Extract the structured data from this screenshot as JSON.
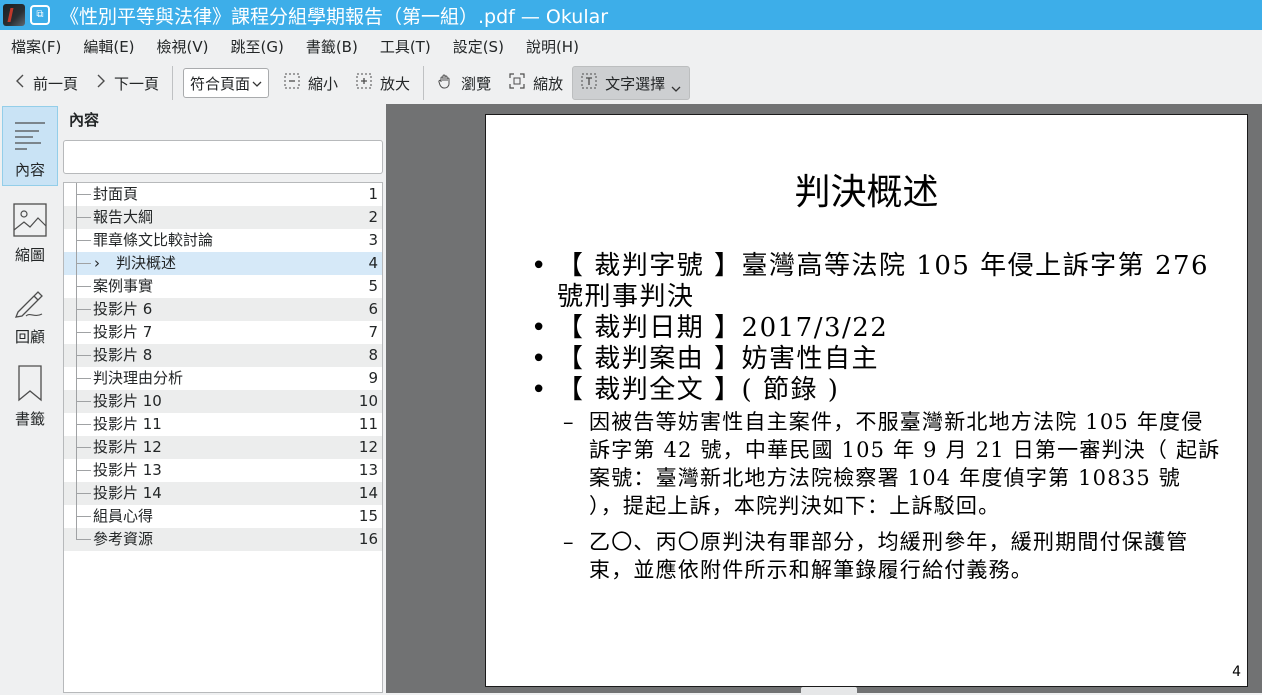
{
  "window": {
    "title": "《性別平等與法律》課程分組學期報告（第一組）.pdf — Okular",
    "pin_glyph": "⧉"
  },
  "menu": [
    "檔案(F)",
    "編輯(E)",
    "檢視(V)",
    "跳至(G)",
    "書籤(B)",
    "工具(T)",
    "設定(S)",
    "說明(H)"
  ],
  "toolbar": {
    "prev_label": "前一頁",
    "next_label": "下一頁",
    "fit_label": "符合頁面",
    "zoom_out_label": "縮小",
    "zoom_in_label": "放大",
    "browse_label": "瀏覽",
    "zoom_tool_label": "縮放",
    "text_select_label": "文字選擇"
  },
  "sidebar_tabs": [
    "內容",
    "縮圖",
    "回顧",
    "書籤"
  ],
  "contents": {
    "title": "內容",
    "search_value": "",
    "items": [
      {
        "label": "封面頁",
        "page": "1"
      },
      {
        "label": "報告大綱",
        "page": "2"
      },
      {
        "label": "罪章條文比較討論",
        "page": "3"
      },
      {
        "label": "判決概述",
        "page": "4",
        "arrow": "›"
      },
      {
        "label": "案例事實",
        "page": "5"
      },
      {
        "label": "投影片 6",
        "page": "6"
      },
      {
        "label": "投影片 7",
        "page": "7"
      },
      {
        "label": "投影片 8",
        "page": "8"
      },
      {
        "label": "判決理由分析",
        "page": "9"
      },
      {
        "label": "投影片 10",
        "page": "10"
      },
      {
        "label": "投影片 11",
        "page": "11"
      },
      {
        "label": "投影片 12",
        "page": "12"
      },
      {
        "label": "投影片 13",
        "page": "13"
      },
      {
        "label": "投影片 14",
        "page": "14"
      },
      {
        "label": "組員心得",
        "page": "15"
      },
      {
        "label": "參考資源",
        "page": "16"
      }
    ]
  },
  "document": {
    "heading": "判決概述",
    "bullets": [
      "【 裁判字號 】臺灣高等法院 105 年侵上訴字第 276 號刑事判決",
      "【 裁判日期 】2017/3/22",
      "【 裁判案由 】妨害性自主",
      "【 裁判全文 】( 節錄 )"
    ],
    "sub_items": [
      "因被告等妨害性自主案件，不服臺灣新北地方法院 105 年度侵訴字第 42 號，中華民國 105 年 9 月 21 日第一審判決（ 起訴案號：臺灣新北地方法院檢察署 104 年度偵字第 10835 號 ），提起上訴，本院判決如下：上訴駁回。",
      "乙〇、丙〇原判決有罪部分，均緩刑參年，緩刑期間付保護管束，並應依附件所示和解筆錄履行給付義務。"
    ],
    "dash": "–",
    "page_number": "4"
  }
}
